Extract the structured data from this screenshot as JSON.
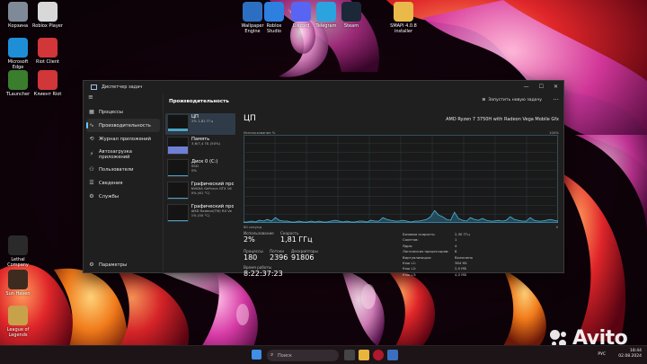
{
  "desktop": {
    "icons": [
      {
        "label": "Корзина",
        "icon": "recycle-bin-icon",
        "color": "#7f8a98"
      },
      {
        "label": "Roblox Player",
        "icon": "roblox-icon",
        "color": "#d8d8d8"
      },
      {
        "label": "Microsoft\nEdge",
        "icon": "edge-icon",
        "color": "#1e8fd6"
      },
      {
        "label": "Riot Client",
        "icon": "riot-icon",
        "color": "#d13639"
      },
      {
        "label": "TLauncher",
        "icon": "tlauncher-icon",
        "color": "#3a7d2c"
      },
      {
        "label": "Клиент Riot",
        "icon": "riot-icon",
        "color": "#d13639"
      },
      {
        "label": "Wallpaper\nEngine",
        "icon": "wallpaper-engine-icon",
        "color": "#2c6fc2"
      },
      {
        "label": "Roblox\nStudio",
        "icon": "roblox-studio-icon",
        "color": "#2d7fe0"
      },
      {
        "label": "Discord",
        "icon": "discord-icon",
        "color": "#5865f2"
      },
      {
        "label": "Telegram",
        "icon": "telegram-icon",
        "color": "#2aa3df"
      },
      {
        "label": "Steam",
        "icon": "steam-icon",
        "color": "#1b2838"
      },
      {
        "label": "SMAPI 4.0.8\ninstaller",
        "icon": "folder-icon",
        "color": "#e9b949"
      },
      {
        "label": "Lethal\nCompany",
        "icon": "game-icon",
        "color": "#2a2a2a"
      },
      {
        "label": "Sun Haven",
        "icon": "game-icon",
        "color": "#3e2b20"
      },
      {
        "label": "League of\nLegends",
        "icon": "league-icon",
        "color": "#c7a24a"
      }
    ]
  },
  "window": {
    "title": "Диспетчер задач",
    "controls": {
      "minimize": "—",
      "maximize": "☐",
      "close": "✕"
    },
    "nav": [
      {
        "label": "Процессы",
        "icon": "processes-icon",
        "glyph": "▦"
      },
      {
        "label": "Производительность",
        "icon": "performance-icon",
        "glyph": "∿"
      },
      {
        "label": "Журнал приложений",
        "icon": "history-icon",
        "glyph": "⟲"
      },
      {
        "label": "Автозагрузка приложений",
        "icon": "startup-icon",
        "glyph": "⚡"
      },
      {
        "label": "Пользователи",
        "icon": "users-icon",
        "glyph": "⚇"
      },
      {
        "label": "Сведения",
        "icon": "details-icon",
        "glyph": "☰"
      },
      {
        "label": "Службы",
        "icon": "services-icon",
        "glyph": "⚙"
      }
    ],
    "settings_label": "Параметры",
    "header_title": "Производительность",
    "run_task_label": "Запустить новую задачу",
    "resources": [
      {
        "name": "ЦП",
        "sub": "2% 1,81 ГГц",
        "level": 0.15
      },
      {
        "name": "Память",
        "sub": "3,6/7,4 ГБ (50%)",
        "level": 0.5
      },
      {
        "name": "Диск 0 (C:)",
        "sub": "SSD\n0%",
        "level": 0.02
      },
      {
        "name": "Графический про",
        "sub": "NVIDIA GeForce GTX 16\n0% (61 °C)",
        "level": 0.02
      },
      {
        "name": "Графический про",
        "sub": "AMD Radeon(TM) RX Ve\n1% (50 °C)",
        "level": 0.03
      }
    ],
    "cpu": {
      "title": "ЦП",
      "model": "AMD Ryzen 7 3750H with Radeon Vega Mobile Gfx",
      "graph_label": "Использование %",
      "graph_max": "100%",
      "graph_time": "60 секунд",
      "graph_min": "0",
      "stats": {
        "usage_label": "Использование",
        "usage": "2%",
        "speed_label": "Скорость",
        "speed": "1,81 ГГц",
        "processes_label": "Процессы",
        "processes": "180",
        "threads_label": "Потоки",
        "threads": "2396",
        "handles_label": "Дескрипторы",
        "handles": "91806",
        "uptime_label": "Время работы",
        "uptime": "8:22:37:23"
      },
      "specs": [
        {
          "k": "Базовая скорость:",
          "v": "2,30 ГГц"
        },
        {
          "k": "Сокетов:",
          "v": "1"
        },
        {
          "k": "Ядра:",
          "v": "4"
        },
        {
          "k": "Логических процессоров:",
          "v": "8"
        },
        {
          "k": "Виртуализация:",
          "v": "Включено"
        },
        {
          "k": "Кэш L1:",
          "v": "384 КБ"
        },
        {
          "k": "Кэш L2:",
          "v": "2,0 МБ"
        },
        {
          "k": "Кэш L3:",
          "v": "4,0 МБ"
        }
      ]
    }
  },
  "taskbar": {
    "search_placeholder": "Поиск",
    "lang": "РУС",
    "time": "18:44",
    "date": "02.08.2024"
  },
  "watermark": {
    "text": "Avito"
  }
}
